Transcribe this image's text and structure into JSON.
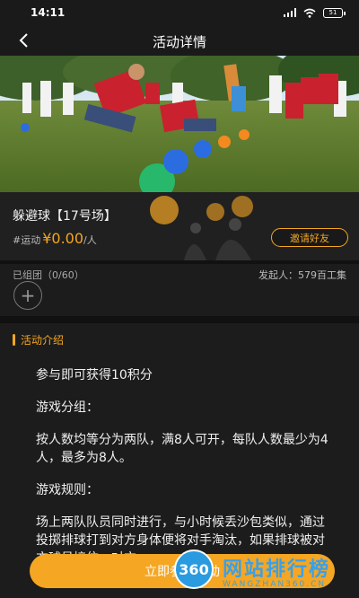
{
  "status_bar": {
    "time": "14:11",
    "battery": "51"
  },
  "nav": {
    "title": "活动详情"
  },
  "activity": {
    "name": "躲避球【17号场】",
    "tag": "#运动",
    "price": "¥0.00",
    "unit": "/人",
    "invite_label": "邀请好友"
  },
  "group": {
    "count_text": "已组团（0/60）",
    "initiator_text": "发起人：579百工集",
    "add_symbol": "+"
  },
  "intro": {
    "header": "活动介绍",
    "paragraphs": [
      "参与即可获得10积分",
      "游戏分组：",
      "按人数均等分为两队，满8人可开，每队人数最少为4人，最多为8人。",
      "游戏规则：",
      "场上两队队员同时进行，与小时候丢沙包类似，通过投掷排球打到对方身体便将对手淘汰，如果排球被对方球员接住，对方"
    ]
  },
  "join_button": {
    "label": "立即参与活动"
  },
  "watermark": {
    "logo": "360",
    "text": "网站排行榜",
    "sub": "WANGZHAN360.CN"
  },
  "colors": {
    "accent": "#f5a623",
    "background": "#1c1c1c"
  }
}
